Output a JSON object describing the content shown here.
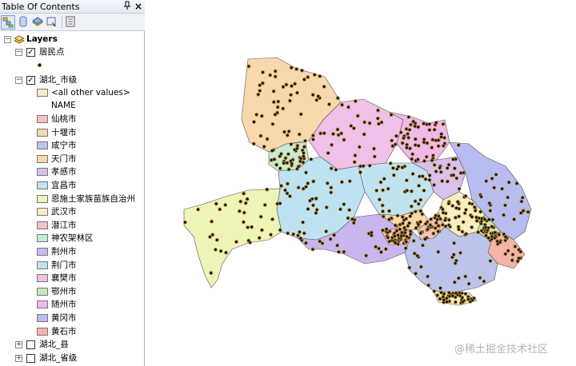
{
  "toc": {
    "title": "Table Of Contents",
    "pin_icon": "q",
    "close_label": "×",
    "root_label": "Layers",
    "layers": [
      {
        "label": "居民点",
        "checked": true,
        "expanded": true
      },
      {
        "label": "湖北_市级",
        "checked": true,
        "expanded": true,
        "field_header": "NAME",
        "other_label": "<all other values>",
        "classes": [
          {
            "label": "仙桃市",
            "color": "#f3c3bd"
          },
          {
            "label": "十堰市",
            "color": "#f8d8ac"
          },
          {
            "label": "咸宁市",
            "color": "#bcc4ec"
          },
          {
            "label": "天门市",
            "color": "#f7d9ad"
          },
          {
            "label": "孝感市",
            "color": "#d9c0ee"
          },
          {
            "label": "宜昌市",
            "color": "#bde3f3"
          },
          {
            "label": "恩施土家族苗族自治州",
            "color": "#eef3b8"
          },
          {
            "label": "武汉市",
            "color": "#f5efc2"
          },
          {
            "label": "潜江市",
            "color": "#f6c3c8"
          },
          {
            "label": "神农架林区",
            "color": "#c8ecd0"
          },
          {
            "label": "荆州市",
            "color": "#c9b6ee"
          },
          {
            "label": "荆门市",
            "color": "#c0e4ef"
          },
          {
            "label": "襄樊市",
            "color": "#f1c0e8"
          },
          {
            "label": "鄂州市",
            "color": "#c4e8b8"
          },
          {
            "label": "随州市",
            "color": "#f2b8ea"
          },
          {
            "label": "黄冈市",
            "color": "#b7bdf0"
          },
          {
            "label": "黄石市",
            "color": "#f6b4a6"
          }
        ]
      },
      {
        "label": "湖北_县",
        "checked": false,
        "expanded": false
      },
      {
        "label": "湖北_省级",
        "checked": false,
        "expanded": false
      }
    ],
    "toolbar_icons": [
      "list-by-drawing-order-icon",
      "list-by-source-icon",
      "list-by-visibility-icon",
      "list-by-selection-icon",
      "options-icon"
    ]
  },
  "map": {
    "point_color": "#111111",
    "point_halo": "#b78a3c",
    "outline_color": "#555555"
  },
  "watermark": "@稀土掘金技术社区"
}
